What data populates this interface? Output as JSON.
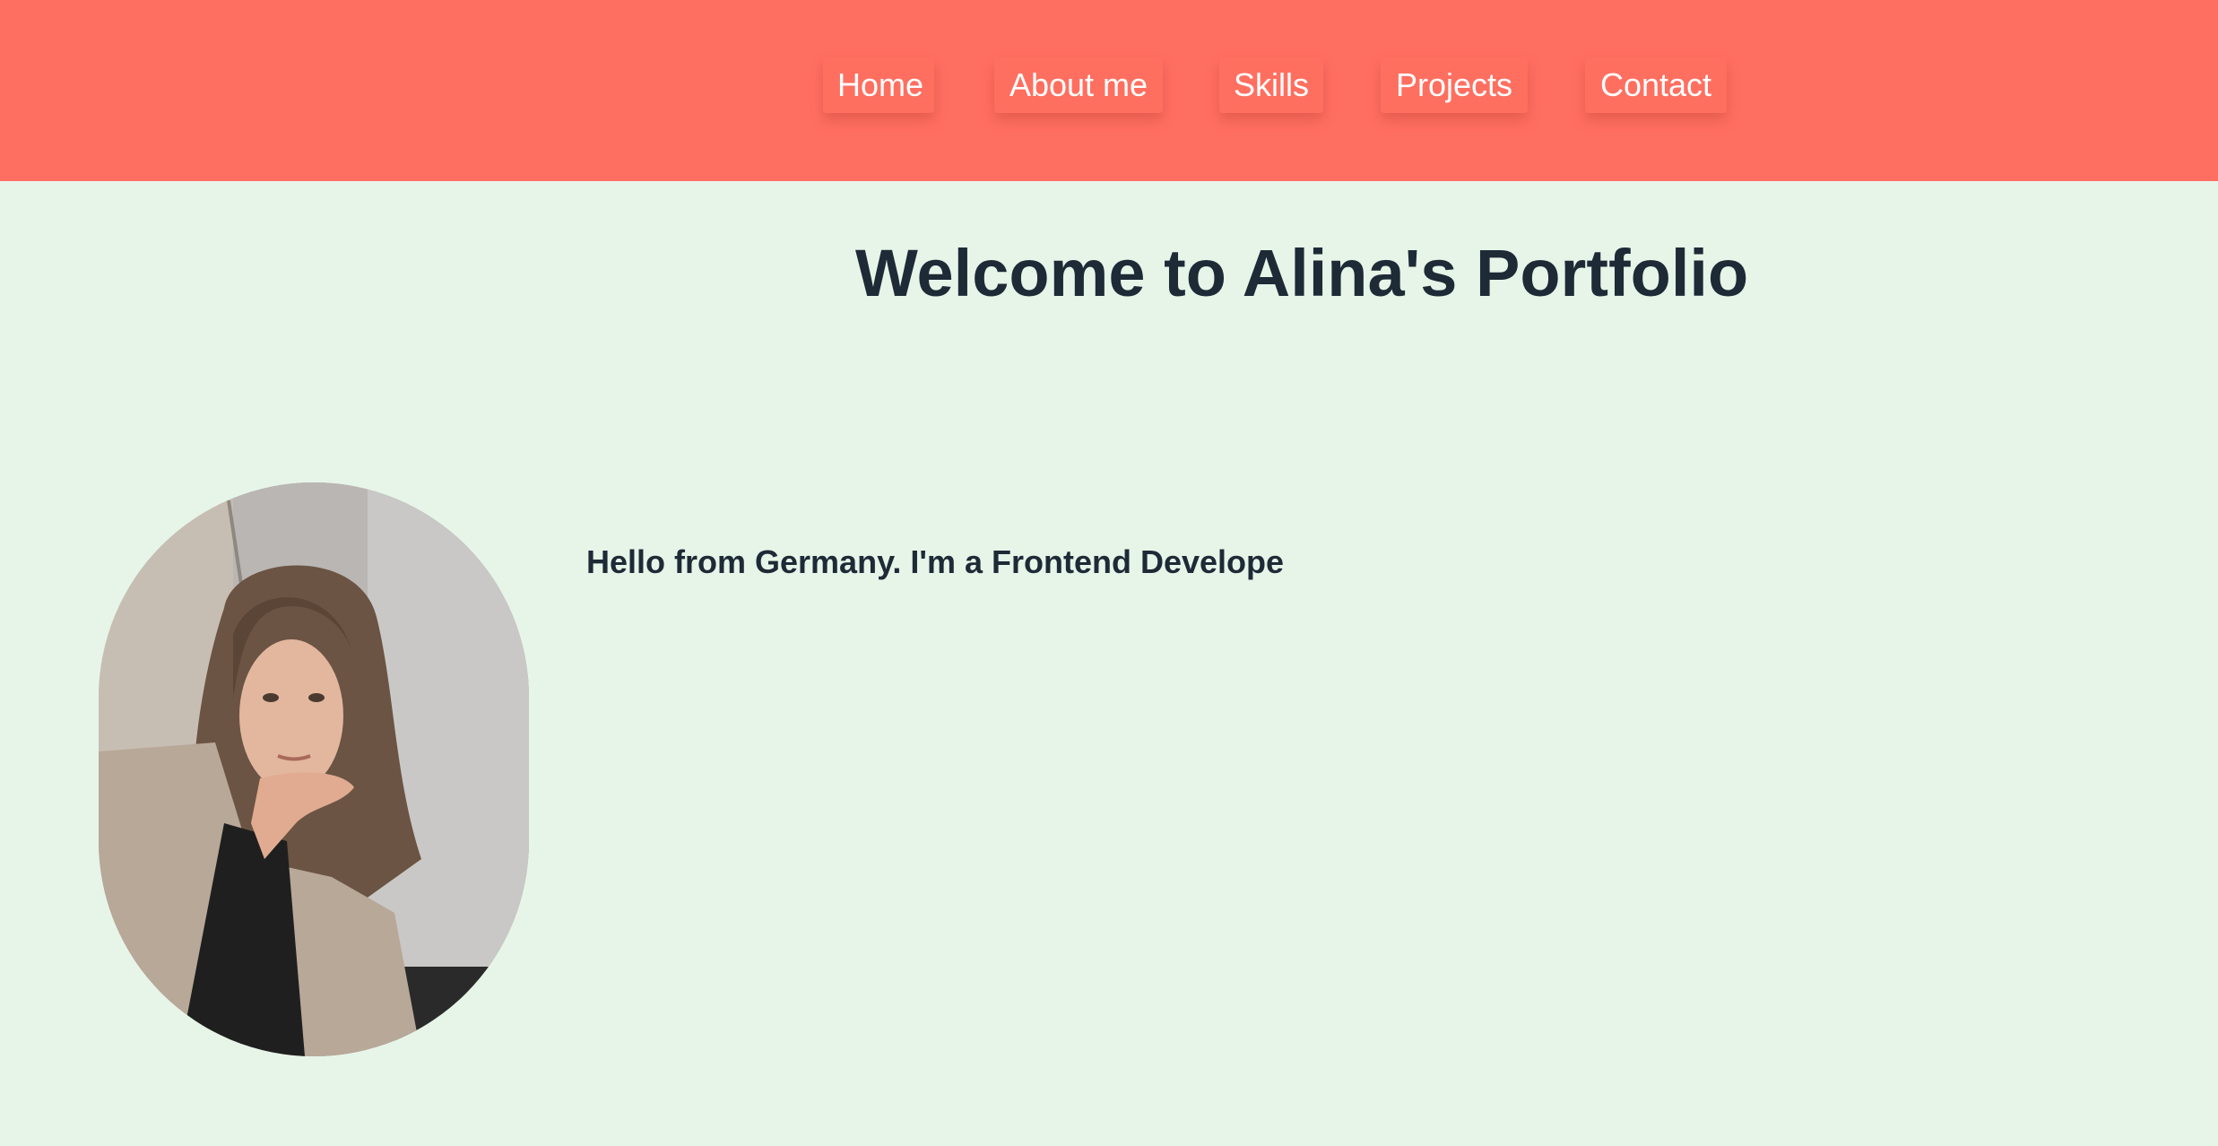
{
  "nav": {
    "items": [
      {
        "label": "Home"
      },
      {
        "label": "About me"
      },
      {
        "label": "Skills"
      },
      {
        "label": "Projects"
      },
      {
        "label": "Contact"
      }
    ]
  },
  "hero": {
    "title": "Welcome to Alina's Portfolio"
  },
  "about": {
    "intro": "Hello from Germany. I'm a Frontend Develope"
  },
  "colors": {
    "header": "#ff6f61",
    "background": "#e7f5e9",
    "text": "#1e2a36"
  }
}
